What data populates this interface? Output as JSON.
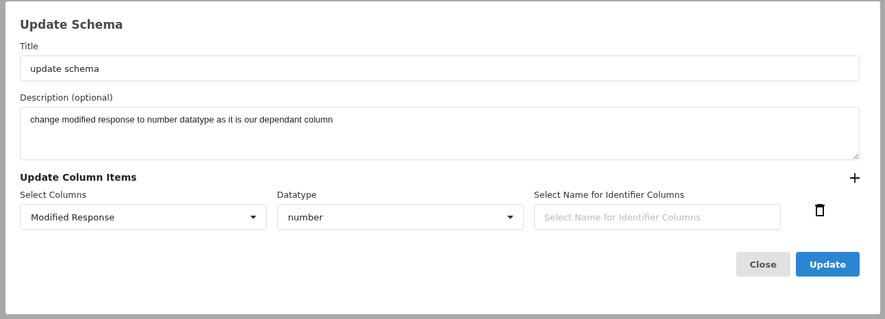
{
  "dialog": {
    "title": "Update Schema"
  },
  "title_field": {
    "label": "Title",
    "value": "update schema"
  },
  "description_field": {
    "label": "Description (optional)",
    "value": "change modified response to number datatype as it is our dependant column"
  },
  "column_items": {
    "heading": "Update Column Items",
    "rows": [
      {
        "fields": [
          {
            "kind": "select",
            "label": "Select Columns",
            "value": "Modified Response"
          },
          {
            "kind": "select",
            "label": "Datatype",
            "value": "number"
          },
          {
            "kind": "input",
            "label": "Select Name for Identifier Columns",
            "placeholder": "Select Name for Identifier Columns"
          }
        ]
      }
    ]
  },
  "buttons": [
    {
      "label": "Close",
      "kind": "secondary"
    },
    {
      "label": "Update",
      "kind": "primary"
    }
  ]
}
